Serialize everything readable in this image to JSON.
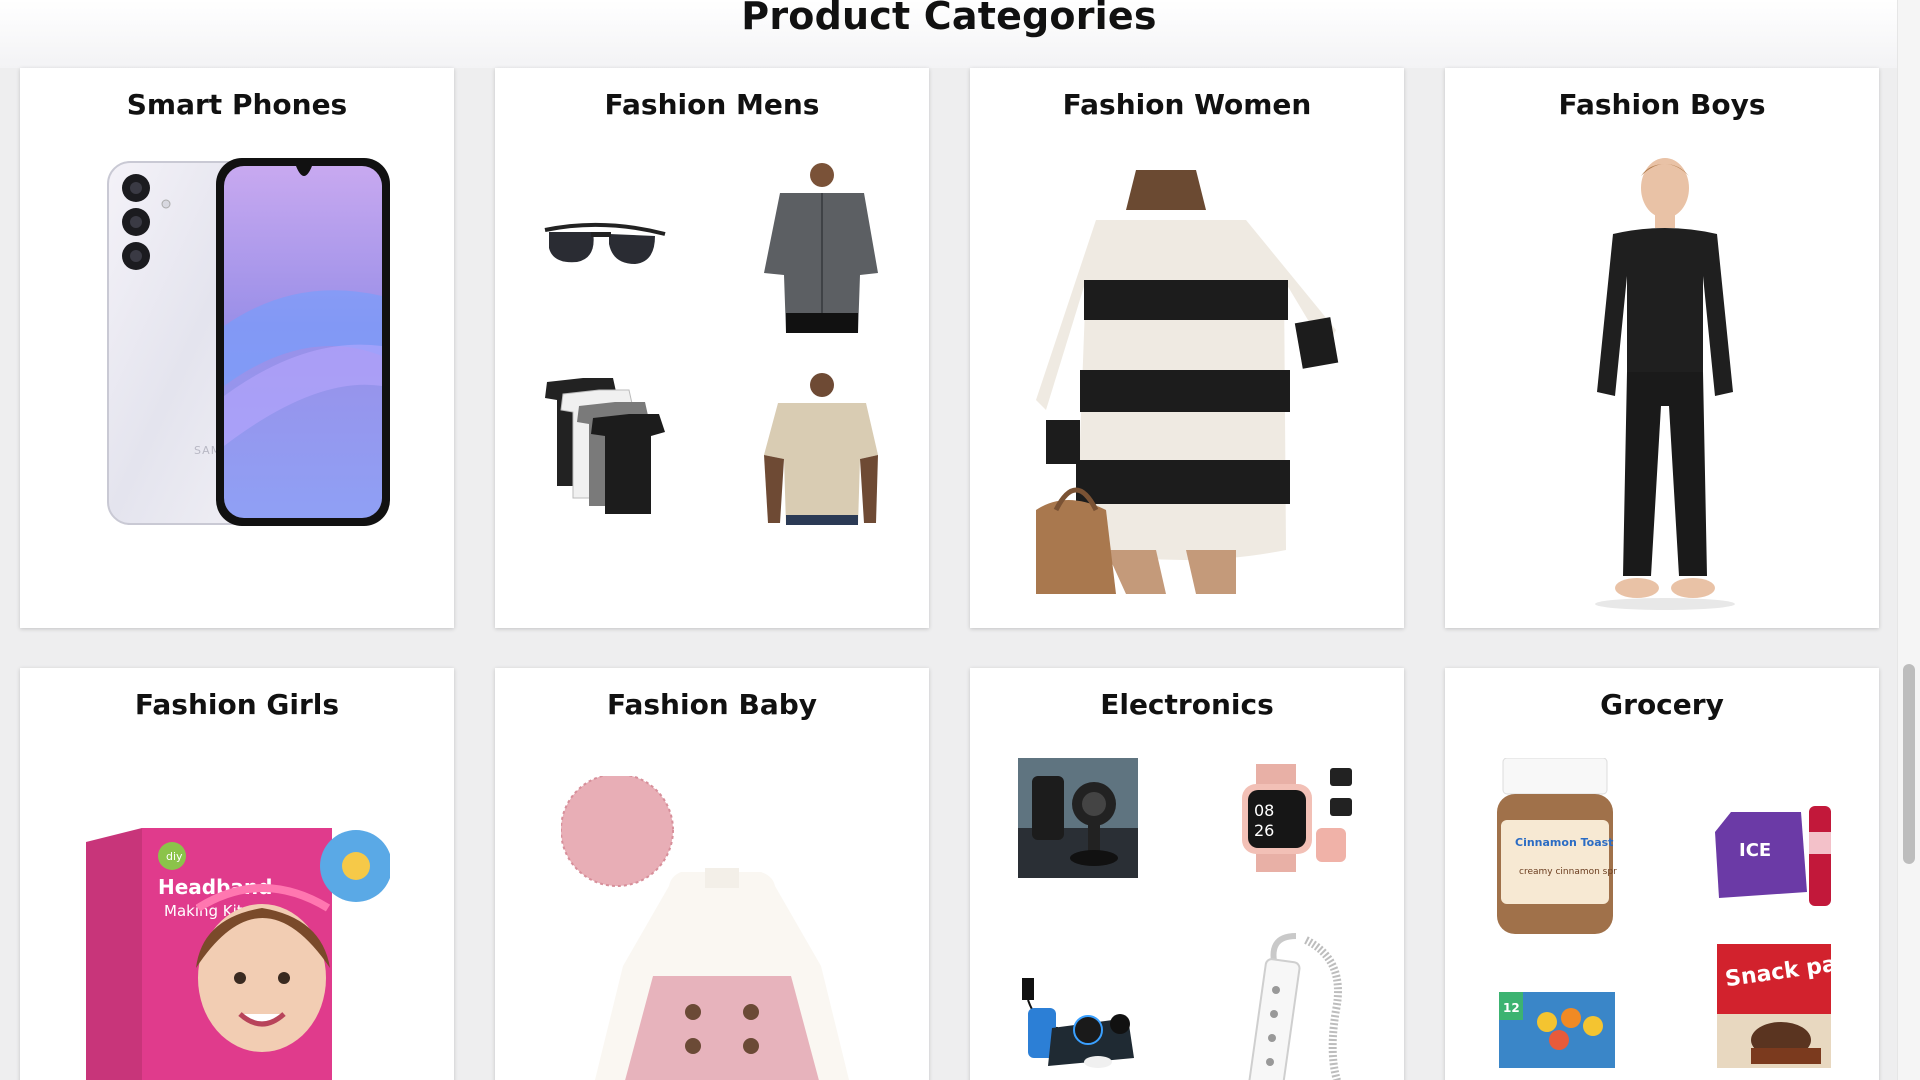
{
  "header": {
    "title": "Product Categories"
  },
  "categories": [
    {
      "title": "Smart Phones",
      "image": "samsung-galaxy-phone",
      "brand_text": "SAMSUNG"
    },
    {
      "title": "Fashion Mens",
      "images": [
        "aviator-sunglasses",
        "grey-button-shirt",
        "stacked-tshirts",
        "beige-tshirt"
      ]
    },
    {
      "title": "Fashion Women",
      "image": "striped-crochet-dress"
    },
    {
      "title": "Fashion Boys",
      "image": "boy-black-thermal-set"
    },
    {
      "title": "Fashion Girls",
      "image": "headband-making-kit",
      "product_text": [
        "diy",
        "Headband",
        "Making Kit"
      ]
    },
    {
      "title": "Fashion Baby",
      "image": "baby-dress-set"
    },
    {
      "title": "Electronics",
      "images": [
        "car-phone-mount",
        "pink-smartwatch",
        "wireless-charging-station",
        "power-strip"
      ]
    },
    {
      "title": "Grocery",
      "images": [
        "cinnamon-spread-jar",
        "sparkling-ice-pack",
        "cereal-variety-box",
        "snack-pack-pudding"
      ],
      "product_text": [
        "Cinnamon Toast Crunch",
        "creamy cinnamon spread",
        "ICE",
        "Snack pack",
        "12"
      ]
    }
  ],
  "colors": {
    "background": "#eeeeef",
    "card": "#ffffff",
    "title": "#111111"
  }
}
